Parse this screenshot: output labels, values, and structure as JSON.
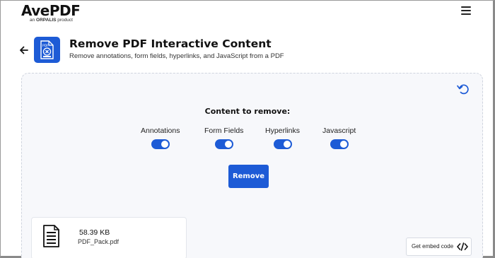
{
  "header": {
    "logo_main": "AvePDF",
    "logo_sub_prefix": "an",
    "logo_sub_brand": "ORPALIS",
    "logo_sub_suffix": "product"
  },
  "title_row": {
    "title": "Remove PDF Interactive Content",
    "subtitle": "Remove annotations, form fields, hyperlinks, and JavaScript from a PDF"
  },
  "options": {
    "heading": "Content to remove:",
    "items": [
      {
        "label": "Annotations",
        "enabled": true
      },
      {
        "label": "Form Fields",
        "enabled": true
      },
      {
        "label": "Hyperlinks",
        "enabled": true
      },
      {
        "label": "Javascript",
        "enabled": true
      }
    ]
  },
  "actions": {
    "remove_label": "Remove",
    "embed_label": "Get embed code"
  },
  "file": {
    "size": "58.39 KB",
    "name": "PDF_Pack.pdf"
  },
  "colors": {
    "accent": "#1d5bd6",
    "panel_bg": "#f7f8fb"
  },
  "icons": {
    "menu": "hamburger-menu-icon",
    "back": "back-arrow-icon",
    "tool": "pdf-remove-icon",
    "reset": "undo-icon",
    "file": "document-icon",
    "embed": "code-icon"
  }
}
